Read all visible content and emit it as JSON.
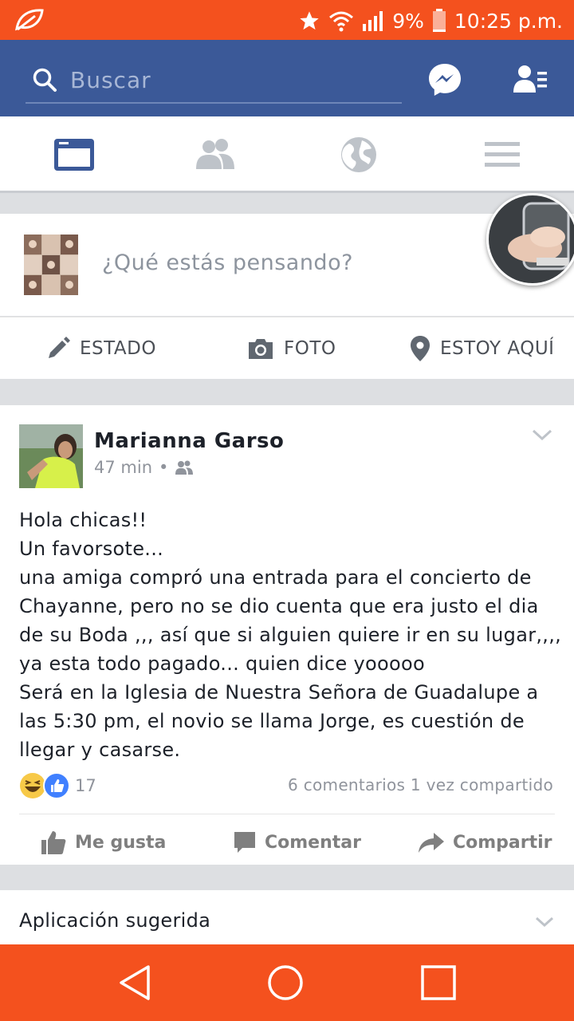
{
  "status_bar": {
    "battery": "9%",
    "time": "10:25 p.m."
  },
  "search": {
    "placeholder": "Buscar"
  },
  "composer": {
    "prompt": "¿Qué estás pensando?"
  },
  "composer_actions": [
    {
      "label": "ESTADO",
      "icon": "pencil-icon"
    },
    {
      "label": "FOTO",
      "icon": "camera-icon"
    },
    {
      "label": "ESTOY AQUÍ",
      "icon": "location-pin-icon"
    }
  ],
  "post": {
    "author": "Marianna Garso",
    "time": "47 min",
    "text_lines": [
      "Hola chicas!!",
      "Un favorsote...",
      "una amiga compró una entrada para el concierto de",
      "Chayanne, pero no se dio cuenta que era justo el dia",
      "de su Boda ,,, así que si alguien quiere ir en su lugar,,,,",
      "ya esta todo pagado... quien dice yooooo",
      "Será en la Iglesia de Nuestra Señora de Guadalupe a",
      "las 5:30 pm, el novio se llama Jorge, es cuestión de",
      "llegar y casarse."
    ],
    "reaction_count": "17",
    "stats": "6 comentarios 1 vez compartido",
    "buttons": {
      "like": "Me gusta",
      "comment": "Comentar",
      "share": "Compartir"
    }
  },
  "suggestion": {
    "title": "Aplicación sugerida"
  },
  "colors": {
    "status_bar": "#f4511e",
    "facebook_blue": "#3b5998",
    "nav_bar": "#f4511e"
  }
}
